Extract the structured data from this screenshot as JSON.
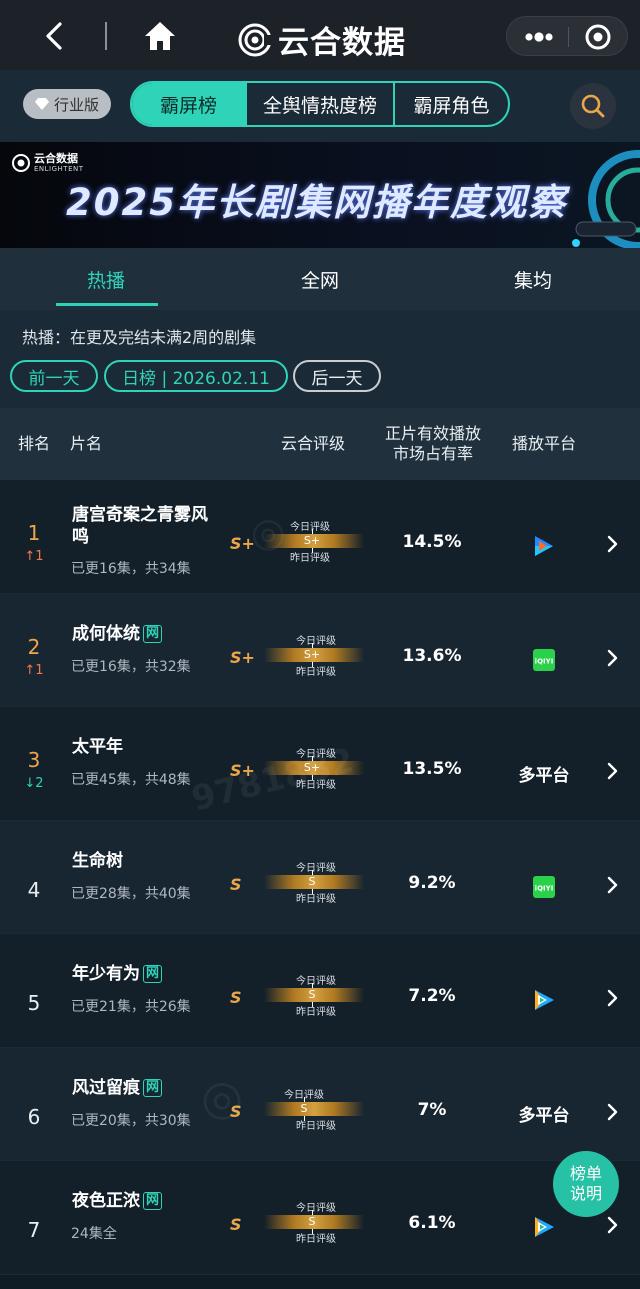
{
  "app": {
    "brand": "云合数据"
  },
  "edition": "行业版",
  "segments": [
    {
      "label": "霸屏榜",
      "active": true
    },
    {
      "label": "全舆情热度榜",
      "active": false
    },
    {
      "label": "霸屏角色",
      "active": false
    }
  ],
  "banner": {
    "logo_cn": "云合数据",
    "logo_en": "ENLIGHTENT",
    "title": "2025年长剧集网播年度观察"
  },
  "tabs": [
    {
      "label": "热播",
      "active": true
    },
    {
      "label": "全网",
      "active": false
    },
    {
      "label": "集均",
      "active": false
    }
  ],
  "hint": "热播：在更及完结未满2周的剧集",
  "pills": {
    "prev": "前一天",
    "current": "日榜 | 2026.02.11",
    "next": "后一天"
  },
  "table": {
    "headers": {
      "rank": "排名",
      "title": "片名",
      "rating": "云合评级",
      "share_line1": "正片有效播放",
      "share_line2": "市场占有率",
      "platform": "播放平台"
    },
    "gauge_top_label": "今日评级",
    "gauge_bottom_label": "昨日评级",
    "rows": [
      {
        "rank": "1",
        "change": "↑1",
        "change_dir": "up",
        "title": "唐宫奇案之青雾风鸣",
        "net": false,
        "sub": "已更16集，共34集",
        "grade": "S+",
        "gauge_letter": "S+",
        "share": "14.5%",
        "platform_icon": "youku-icon",
        "platform_text": ""
      },
      {
        "rank": "2",
        "change": "↑1",
        "change_dir": "up",
        "title": "成何体统",
        "net": true,
        "net_label": "网",
        "sub": "已更16集，共32集",
        "grade": "S+",
        "gauge_letter": "S+",
        "share": "13.6%",
        "platform_icon": "iqiyi-icon",
        "platform_text": ""
      },
      {
        "rank": "3",
        "change": "↓2",
        "change_dir": "down",
        "title": "太平年",
        "net": false,
        "sub": "已更45集，共48集",
        "grade": "S+",
        "gauge_letter": "S+",
        "share": "13.5%",
        "platform_icon": "",
        "platform_text": "多平台"
      },
      {
        "rank": "4",
        "change": "",
        "change_dir": "",
        "title": "生命树",
        "net": false,
        "sub": "已更28集，共40集",
        "grade": "S",
        "gauge_letter": "S",
        "share": "9.2%",
        "platform_icon": "iqiyi-icon",
        "platform_text": ""
      },
      {
        "rank": "5",
        "change": "",
        "change_dir": "",
        "title": "年少有为",
        "net": true,
        "net_label": "网",
        "sub": "已更21集，共26集",
        "grade": "S",
        "gauge_letter": "S",
        "share": "7.2%",
        "platform_icon": "tencent-video-icon",
        "platform_text": ""
      },
      {
        "rank": "6",
        "change": "",
        "change_dir": "",
        "title": "风过留痕",
        "net": true,
        "net_label": "网",
        "sub": "已更20集，共30集",
        "grade": "S",
        "gauge_letter": "S",
        "share": "7%",
        "platform_icon": "",
        "platform_text": "多平台"
      },
      {
        "rank": "7",
        "change": "",
        "change_dir": "",
        "title": "夜色正浓",
        "net": true,
        "net_label": "网",
        "sub": "24集全",
        "grade": "S",
        "gauge_letter": "S",
        "share": "6.1%",
        "platform_icon": "tencent-video-icon",
        "platform_text": ""
      }
    ]
  },
  "float_button": {
    "line1": "榜单",
    "line2": "说明"
  },
  "colors": {
    "accent": "#2ed3b8",
    "grade": "#e9a74a",
    "up": "#f07a4a",
    "down": "#2ed3b8",
    "rank_top": "#f0a74a"
  },
  "watermark": "9781882"
}
